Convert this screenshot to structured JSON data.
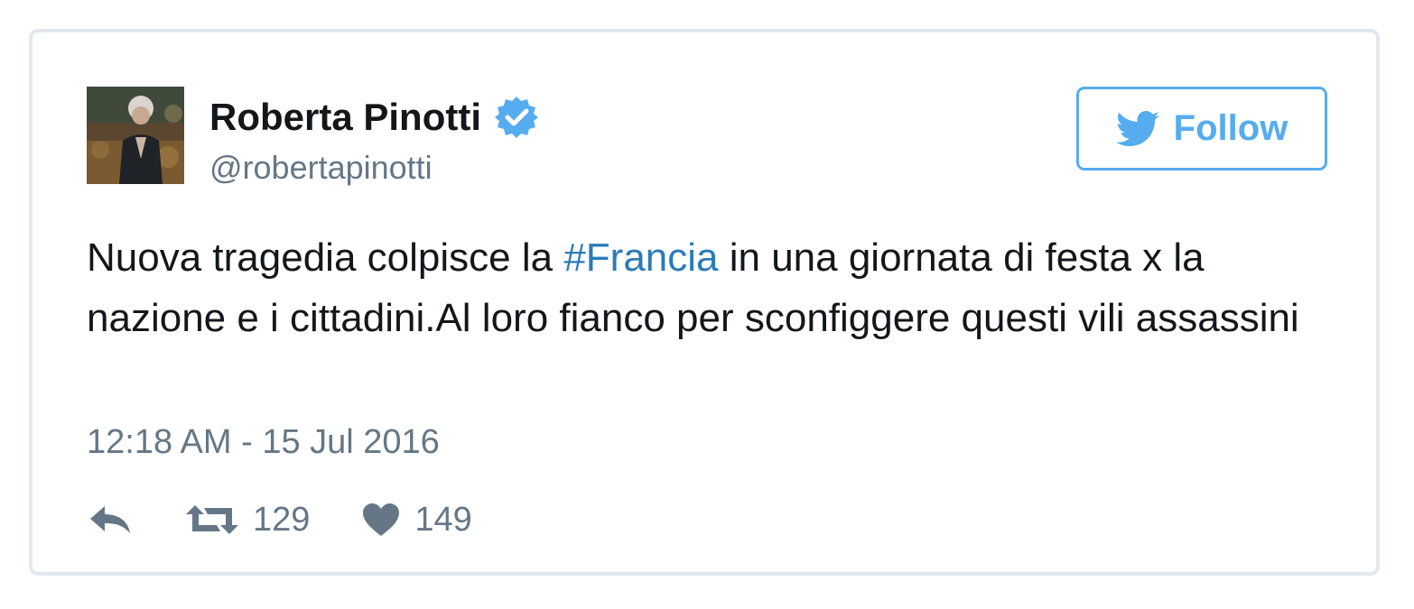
{
  "user": {
    "display_name": "Roberta Pinotti",
    "handle": "@robertapinotti",
    "verified": true
  },
  "follow_button": {
    "label": "Follow"
  },
  "tweet": {
    "text_before": "Nuova tragedia colpisce la ",
    "hashtag": "#Francia",
    "text_after": " in una giornata di festa x la nazione e i cittadini.Al loro fianco per sconfiggere questi vili assassini",
    "timestamp": "12:18 AM - 15 Jul 2016"
  },
  "actions": {
    "reply_icon": "reply-icon",
    "retweet_icon": "retweet-icon",
    "like_icon": "heart-icon",
    "retweet_count": "129",
    "like_count": "149"
  },
  "colors": {
    "accent": "#55acee",
    "link": "#2b7bb9",
    "text": "#14171a",
    "muted": "#657786",
    "border": "#e1e8ed"
  }
}
